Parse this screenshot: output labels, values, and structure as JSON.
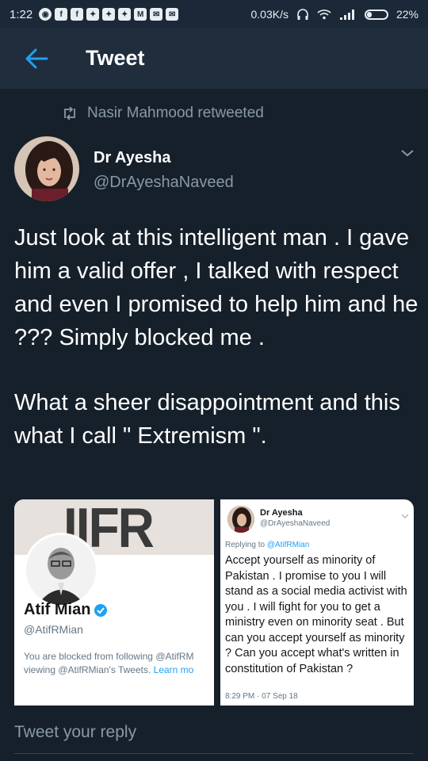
{
  "status_bar": {
    "time": "1:22",
    "net_speed": "0.03K/s",
    "battery": "22%",
    "app_icons": [
      {
        "name": "whatsapp-icon",
        "glyph": "◉"
      },
      {
        "name": "facebook-icon",
        "glyph": "f"
      },
      {
        "name": "facebook-icon-2",
        "glyph": "f"
      },
      {
        "name": "twitter-icon",
        "glyph": "✦"
      },
      {
        "name": "twitter-icon-2",
        "glyph": "✦"
      },
      {
        "name": "twitter-icon-3",
        "glyph": "✦"
      },
      {
        "name": "gmail-icon",
        "glyph": "M"
      },
      {
        "name": "messenger-icon",
        "glyph": "✉"
      },
      {
        "name": "messenger-icon-2",
        "glyph": "✉"
      }
    ]
  },
  "header": {
    "title": "Tweet"
  },
  "retweet": {
    "text": "Nasir Mahmood retweeted"
  },
  "author": {
    "name": "Dr Ayesha",
    "handle": "@DrAyeshaNaveed"
  },
  "tweet": {
    "paragraphs": [
      "Just look at this intelligent man . I gave him a valid offer , I talked with respect and even I promised to help him and he ??? Simply blocked me .",
      "What a sheer disappointment and this what I call \" Extremism \"."
    ]
  },
  "media_left": {
    "banner_text": "IIFR",
    "name": "Atif Mian",
    "handle": "@AtifRMian",
    "blocked_line1": "You are blocked from following @AtifRM",
    "blocked_line2_prefix": "viewing @AtifRMian's Tweets. ",
    "learn_more": "Learn mo"
  },
  "media_right": {
    "name": "Dr Ayesha",
    "handle": "@DrAyeshaNaveed",
    "reply_prefix": "Replying to ",
    "reply_to": "@AtifRMian",
    "text": "Accept yourself as minority of Pakistan . I promise to you I will stand as a social media activist with you . I will fight for you to get a ministry even on minority seat . But can you accept yourself as minority ? Can you accept what's written in constitution of Pakistan ?",
    "timestamp": "8:29 PM · 07 Sep 18"
  },
  "reply": {
    "placeholder": "Tweet your reply"
  },
  "colors": {
    "background": "#15202b",
    "accent": "#1da1f2",
    "muted": "#8899a6"
  }
}
